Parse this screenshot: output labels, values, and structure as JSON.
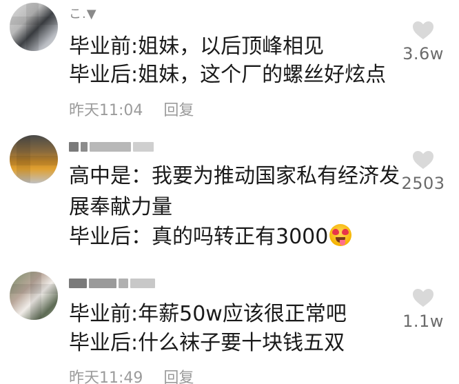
{
  "comments": [
    {
      "username": "こ.▼",
      "lines": [
        "毕业前:姐妹，以后顶峰相见",
        "毕业后:姐妹，这个厂的螺丝好炫点"
      ],
      "time": "昨天11:04",
      "reply": "回复",
      "likes": "3.6w"
    },
    {
      "username": "",
      "lines": [
        "高中是：我要为推动国家私有经济发",
        "展奉献力量",
        "毕业后：真的吗转正有3000"
      ],
      "likes": "2503"
    },
    {
      "username": "",
      "lines": [
        "毕业前:年薪50w应该很正常吧",
        "毕业后:什么袜子要十块钱五双"
      ],
      "time": "昨天11:49",
      "reply": "回复",
      "likes": "1.1w"
    }
  ],
  "colors": {
    "text": "#1a1a1a",
    "meta": "#9b9b9b",
    "heart": "#d9d9d9",
    "count": "#6b6b6b"
  },
  "icons": {
    "like": "heart-icon",
    "emoji": "heart-eyes-tongue-emoji"
  }
}
